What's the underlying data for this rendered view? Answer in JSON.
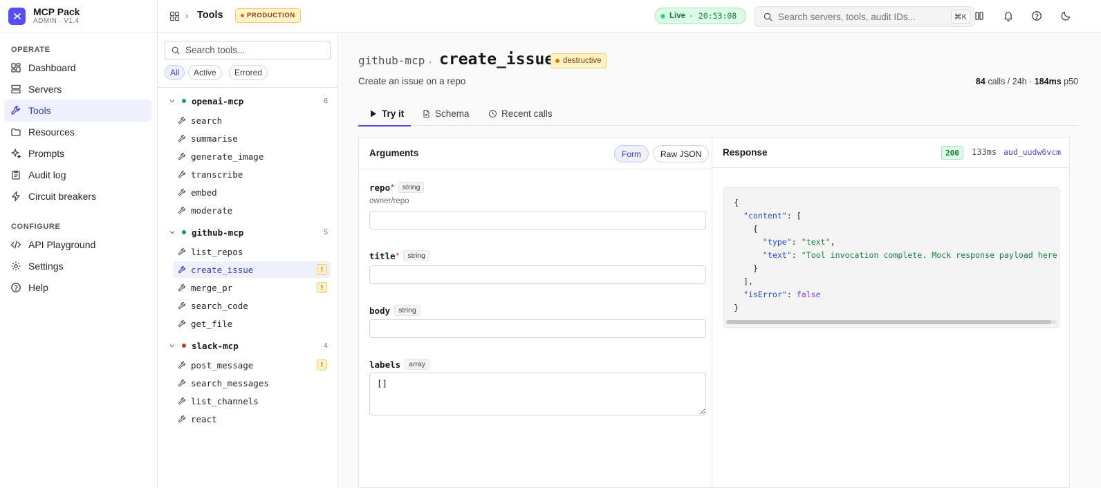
{
  "brand": {
    "name": "MCP Pack",
    "sub": "ADMIN · V1.4"
  },
  "nav": {
    "operate_label": "OPERATE",
    "configure_label": "CONFIGURE",
    "items": [
      {
        "label": "Dashboard",
        "icon": "dashboard-icon"
      },
      {
        "label": "Servers",
        "icon": "servers-icon"
      },
      {
        "label": "Tools",
        "icon": "wrench-icon"
      },
      {
        "label": "Resources",
        "icon": "folder-icon"
      },
      {
        "label": "Prompts",
        "icon": "sparkle-icon"
      },
      {
        "label": "Audit log",
        "icon": "clipboard-icon"
      },
      {
        "label": "Circuit breakers",
        "icon": "lightning-icon"
      },
      {
        "label": "API Playground",
        "icon": "code-icon"
      },
      {
        "label": "Settings",
        "icon": "gear-icon"
      },
      {
        "label": "Help",
        "icon": "help-icon"
      }
    ]
  },
  "topbar": {
    "title": "Tools",
    "env": "PRODUCTION",
    "live_label": "Live",
    "live_time": "· 20:53:08",
    "search_placeholder": "Search servers, tools, audit IDs...",
    "search_shortcut": "⌘K"
  },
  "tools_panel": {
    "search_placeholder": "Search tools...",
    "filters": [
      "All",
      "Active",
      "Errored"
    ],
    "groups": [
      {
        "name": "openai-mcp",
        "count": "6",
        "status_color": "#16a34a",
        "tools": [
          {
            "name": "search"
          },
          {
            "name": "summarise"
          },
          {
            "name": "generate_image"
          },
          {
            "name": "transcribe"
          },
          {
            "name": "embed"
          },
          {
            "name": "moderate"
          }
        ]
      },
      {
        "name": "github-mcp",
        "count": "5",
        "status_color": "#16a34a",
        "tools": [
          {
            "name": "list_repos"
          },
          {
            "name": "create_issue"
          },
          {
            "name": "merge_pr"
          },
          {
            "name": "search_code"
          },
          {
            "name": "get_file"
          }
        ]
      },
      {
        "name": "slack-mcp",
        "count": "4",
        "status_color": "#c2410c",
        "tools": [
          {
            "name": "post_message"
          },
          {
            "name": "search_messages"
          },
          {
            "name": "list_channels"
          },
          {
            "name": "react"
          }
        ]
      }
    ],
    "warn_glyph": "!"
  },
  "tool": {
    "server": "github-mcp",
    "separator": ".",
    "name": "create_issue",
    "badge": "destructive",
    "description": "Create an issue on a repo",
    "stats_calls": "84",
    "stats_calls_label": "calls / 24h ·",
    "stats_latency": "184ms",
    "stats_latency_label": "p50"
  },
  "tabs": [
    "Try it",
    "Schema",
    "Recent calls"
  ],
  "arguments": {
    "title": "Arguments",
    "modes": [
      "Form",
      "Raw JSON"
    ],
    "fields": [
      {
        "name": "repo",
        "required": "*",
        "type": "string",
        "hint": "owner/repo",
        "value": ""
      },
      {
        "name": "title",
        "required": "*",
        "type": "string",
        "value": ""
      },
      {
        "name": "body",
        "type": "string",
        "value": ""
      },
      {
        "name": "labels",
        "type": "array",
        "value": "[]"
      }
    ]
  },
  "response": {
    "title": "Response",
    "status": "200",
    "time": "133ms",
    "audit_id": "aud_uudw6vcm",
    "json": {
      "content_key": "\"content\"",
      "type_key": "\"type\"",
      "type_val": "\"text\"",
      "text_key": "\"text\"",
      "text_val": "\"Tool invocation complete. Mock response payload here.\"",
      "iserror_key": "\"isError\"",
      "iserror_val": "false"
    }
  },
  "colors": {
    "accent": "#4f46e5",
    "brand": "#5b4ef0",
    "warning": "#d97706",
    "success": "#16a34a"
  }
}
